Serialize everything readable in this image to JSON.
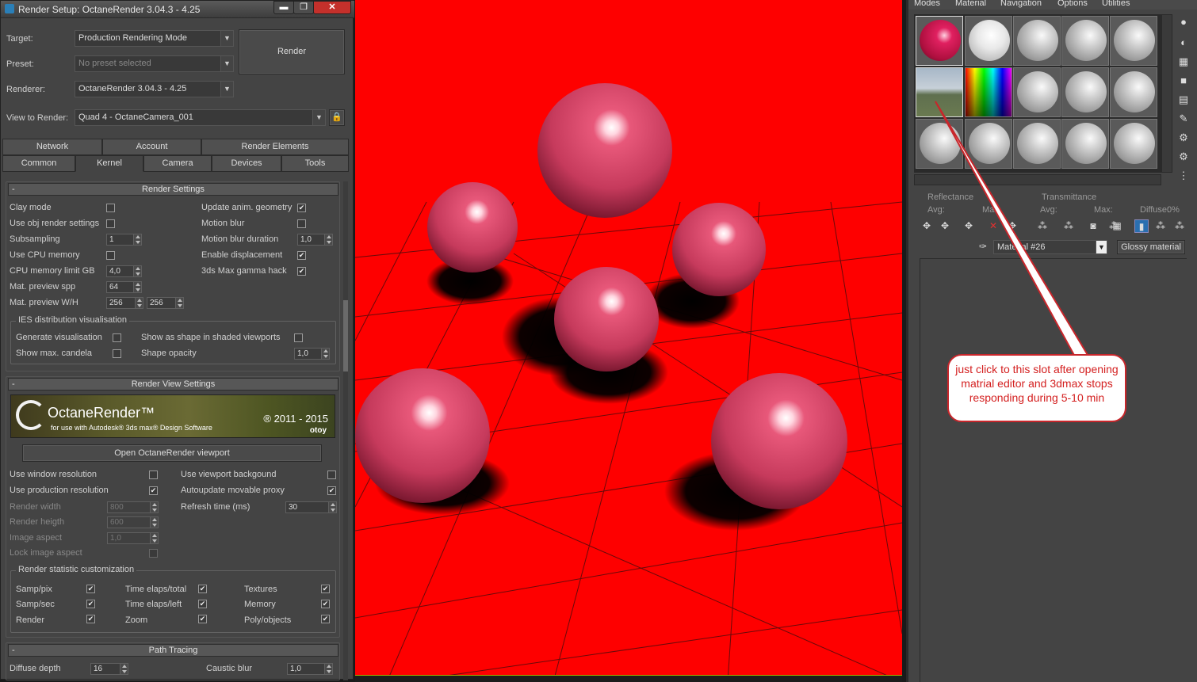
{
  "window": {
    "title": "Render Setup: OctaneRender 3.04.3 - 4.25",
    "min_label": "▬",
    "max_label": "❐",
    "close_label": "✕"
  },
  "top": {
    "target_label": "Target:",
    "target_value": "Production Rendering Mode",
    "preset_label": "Preset:",
    "preset_value": "No preset selected",
    "renderer_label": "Renderer:",
    "renderer_value": "OctaneRender 3.04.3 - 4.25",
    "view_label": "View to Render:",
    "view_value": "Quad 4 - OctaneCamera_001",
    "render_button": "Render",
    "lock_icon": "lock-icon"
  },
  "tabs_row1": [
    "Network",
    "Account",
    "Render Elements"
  ],
  "tabs_row2": [
    "Common",
    "Kernel",
    "Camera",
    "Devices",
    "Tools"
  ],
  "active_tab": "Kernel",
  "render_settings": {
    "title": "Render Settings",
    "left": [
      {
        "label": "Clay mode",
        "checked": false
      },
      {
        "label": "Use obj render settings",
        "checked": false
      },
      {
        "label": "Subsampling",
        "value": "1"
      },
      {
        "label": "Use CPU memory",
        "checked": false
      },
      {
        "label": "CPU memory limit GB",
        "value": "4,0"
      },
      {
        "label": "Mat. preview spp",
        "value": "64"
      },
      {
        "label": "Mat. preview W/H",
        "value": "256",
        "value2": "256"
      }
    ],
    "right": [
      {
        "label": "Update anim. geometry",
        "checked": true
      },
      {
        "label": "Motion blur",
        "checked": false
      },
      {
        "label": "Motion blur duration",
        "value": "1,0"
      },
      {
        "label": "Enable displacement",
        "checked": true
      },
      {
        "label": "3ds Max gamma hack",
        "checked": true
      }
    ],
    "ies_group": "IES distribution visualisation",
    "ies": {
      "generate": "Generate visualisation",
      "show_shape": "Show as shape in shaded viewports",
      "show_candela": "Show max. candela",
      "shape_opacity": "Shape opacity",
      "shape_opacity_value": "1,0"
    }
  },
  "render_view": {
    "title": "Render View Settings",
    "banner_title": "OctaneRender™",
    "banner_sub": "for use with Autodesk® 3ds max® Design Software",
    "banner_copy": "® 2011 - 2015",
    "banner_brand": "otoy",
    "open_button": "Open OctaneRender viewport",
    "left": [
      {
        "label": "Use window resolution",
        "checked": false
      },
      {
        "label": "Use production resolution",
        "checked": true
      },
      {
        "label": "Render width",
        "value": "800"
      },
      {
        "label": "Render heigth",
        "value": "600"
      },
      {
        "label": "Image aspect",
        "value": "1,0"
      },
      {
        "label": "Lock image aspect",
        "checked": false
      }
    ],
    "right": [
      {
        "label": "Use viewport backgound",
        "checked": false
      },
      {
        "label": "Autoupdate movable proxy",
        "checked": true
      },
      {
        "label": "Refresh time (ms)",
        "value": "30"
      }
    ],
    "stats_group": "Render statistic customization",
    "stats": [
      [
        "Samp/pix",
        "Time elaps/total",
        "Textures"
      ],
      [
        "Samp/sec",
        "Time elaps/left",
        "Memory"
      ],
      [
        "Render",
        "Zoom",
        "Poly/objects"
      ]
    ]
  },
  "path_tracing": {
    "title": "Path Tracing",
    "diffuse_label": "Diffuse depth",
    "diffuse_value": "16",
    "caustic_label": "Caustic blur",
    "caustic_value": "1,0"
  },
  "material_editor": {
    "menu": [
      "Modes",
      "Material",
      "Navigation",
      "Options",
      "Utilities"
    ],
    "reflectance": "Reflectance",
    "transmittance": "Transmittance",
    "avg": "Avg:",
    "max": "Max:",
    "diffuse": "Diffuse:",
    "diffuse_value": "0%",
    "material_name": "Material #26",
    "material_type": "Glossy material"
  },
  "callout": {
    "text": "just click to this slot after opening matrial editor and 3dmax stops responding during 5-10 min"
  },
  "colors": {
    "viewport_bg": "#fe0000",
    "sphere": "#c8385a",
    "callout_border": "#c8262b",
    "callout_text": "#d42020"
  }
}
